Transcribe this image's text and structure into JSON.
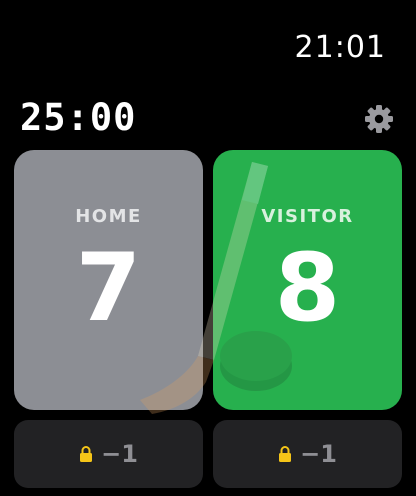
{
  "status_bar": {
    "time": "21:01"
  },
  "game": {
    "timer": "25:00"
  },
  "teams": {
    "home": {
      "label": "HOME",
      "score": "7",
      "color": "#8c8e94"
    },
    "visitor": {
      "label": "VISITOR",
      "score": "8",
      "color": "#27b04e"
    }
  },
  "penalties": {
    "home": {
      "icon": "lock-icon",
      "value": "−1"
    },
    "visitor": {
      "icon": "lock-icon",
      "value": "−1"
    }
  },
  "colors": {
    "lock": "#f5c518",
    "background": "#000000"
  }
}
